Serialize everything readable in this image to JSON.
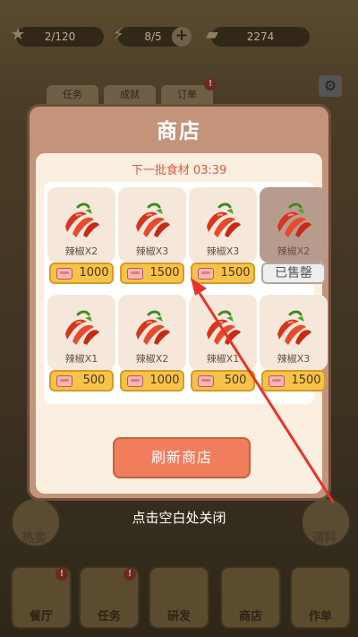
{
  "hud": {
    "stars": "2/120",
    "energy": "8/5",
    "cash": "2274"
  },
  "bg_tabs": [
    "任务",
    "成就",
    "订单"
  ],
  "side_buttons": {
    "left_label": "热卖",
    "right_label": "调料"
  },
  "bottom_nav": [
    "餐厅",
    "任务",
    "研发",
    "商店",
    "作单"
  ],
  "shop": {
    "title": "商店",
    "timer_label": "下一批食材",
    "timer_value": "03:39",
    "items": [
      {
        "name": "辣椒X2",
        "price": "1000",
        "sold": false
      },
      {
        "name": "辣椒X3",
        "price": "1500",
        "sold": false
      },
      {
        "name": "辣椒X3",
        "price": "1500",
        "sold": false
      },
      {
        "name": "辣椒X2",
        "price": "",
        "sold": true
      },
      {
        "name": "辣椒X1",
        "price": "500",
        "sold": false
      },
      {
        "name": "辣椒X2",
        "price": "1000",
        "sold": false
      },
      {
        "name": "辣椒X1",
        "price": "500",
        "sold": false
      },
      {
        "name": "辣椒X3",
        "price": "1500",
        "sold": false
      }
    ],
    "sold_out_label": "已售罄",
    "refresh_label": "刷新商店",
    "close_hint": "点击空白处关闭"
  },
  "colors": {
    "modal_frame": "#c3937a",
    "price_button": "#f6c34a",
    "refresh_button": "#f07e5c",
    "timer_text": "#d85b45",
    "arrow": "#e8322a"
  },
  "icons": {
    "price": "meat-icon",
    "item": "chili-pepper-icon",
    "settings": "gear-icon"
  }
}
